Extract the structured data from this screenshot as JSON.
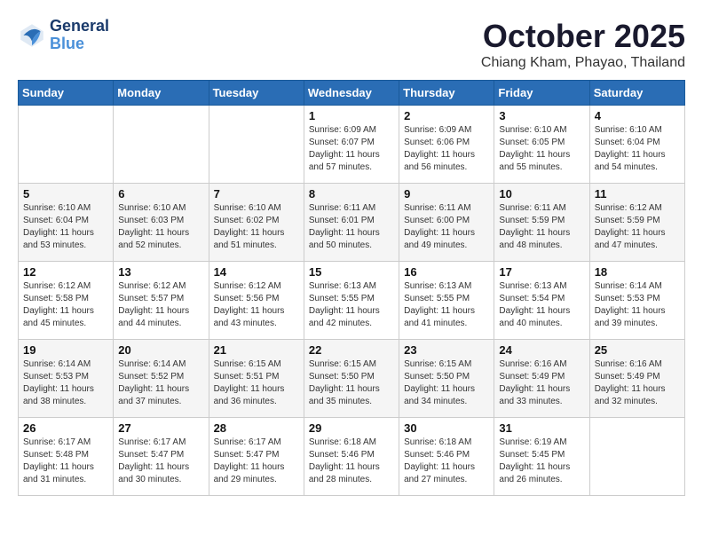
{
  "header": {
    "logo_line1": "General",
    "logo_line2": "Blue",
    "month": "October 2025",
    "location": "Chiang Kham, Phayao, Thailand"
  },
  "weekdays": [
    "Sunday",
    "Monday",
    "Tuesday",
    "Wednesday",
    "Thursday",
    "Friday",
    "Saturday"
  ],
  "weeks": [
    [
      {
        "day": "",
        "info": ""
      },
      {
        "day": "",
        "info": ""
      },
      {
        "day": "",
        "info": ""
      },
      {
        "day": "1",
        "info": "Sunrise: 6:09 AM\nSunset: 6:07 PM\nDaylight: 11 hours\nand 57 minutes."
      },
      {
        "day": "2",
        "info": "Sunrise: 6:09 AM\nSunset: 6:06 PM\nDaylight: 11 hours\nand 56 minutes."
      },
      {
        "day": "3",
        "info": "Sunrise: 6:10 AM\nSunset: 6:05 PM\nDaylight: 11 hours\nand 55 minutes."
      },
      {
        "day": "4",
        "info": "Sunrise: 6:10 AM\nSunset: 6:04 PM\nDaylight: 11 hours\nand 54 minutes."
      }
    ],
    [
      {
        "day": "5",
        "info": "Sunrise: 6:10 AM\nSunset: 6:04 PM\nDaylight: 11 hours\nand 53 minutes."
      },
      {
        "day": "6",
        "info": "Sunrise: 6:10 AM\nSunset: 6:03 PM\nDaylight: 11 hours\nand 52 minutes."
      },
      {
        "day": "7",
        "info": "Sunrise: 6:10 AM\nSunset: 6:02 PM\nDaylight: 11 hours\nand 51 minutes."
      },
      {
        "day": "8",
        "info": "Sunrise: 6:11 AM\nSunset: 6:01 PM\nDaylight: 11 hours\nand 50 minutes."
      },
      {
        "day": "9",
        "info": "Sunrise: 6:11 AM\nSunset: 6:00 PM\nDaylight: 11 hours\nand 49 minutes."
      },
      {
        "day": "10",
        "info": "Sunrise: 6:11 AM\nSunset: 5:59 PM\nDaylight: 11 hours\nand 48 minutes."
      },
      {
        "day": "11",
        "info": "Sunrise: 6:12 AM\nSunset: 5:59 PM\nDaylight: 11 hours\nand 47 minutes."
      }
    ],
    [
      {
        "day": "12",
        "info": "Sunrise: 6:12 AM\nSunset: 5:58 PM\nDaylight: 11 hours\nand 45 minutes."
      },
      {
        "day": "13",
        "info": "Sunrise: 6:12 AM\nSunset: 5:57 PM\nDaylight: 11 hours\nand 44 minutes."
      },
      {
        "day": "14",
        "info": "Sunrise: 6:12 AM\nSunset: 5:56 PM\nDaylight: 11 hours\nand 43 minutes."
      },
      {
        "day": "15",
        "info": "Sunrise: 6:13 AM\nSunset: 5:55 PM\nDaylight: 11 hours\nand 42 minutes."
      },
      {
        "day": "16",
        "info": "Sunrise: 6:13 AM\nSunset: 5:55 PM\nDaylight: 11 hours\nand 41 minutes."
      },
      {
        "day": "17",
        "info": "Sunrise: 6:13 AM\nSunset: 5:54 PM\nDaylight: 11 hours\nand 40 minutes."
      },
      {
        "day": "18",
        "info": "Sunrise: 6:14 AM\nSunset: 5:53 PM\nDaylight: 11 hours\nand 39 minutes."
      }
    ],
    [
      {
        "day": "19",
        "info": "Sunrise: 6:14 AM\nSunset: 5:53 PM\nDaylight: 11 hours\nand 38 minutes."
      },
      {
        "day": "20",
        "info": "Sunrise: 6:14 AM\nSunset: 5:52 PM\nDaylight: 11 hours\nand 37 minutes."
      },
      {
        "day": "21",
        "info": "Sunrise: 6:15 AM\nSunset: 5:51 PM\nDaylight: 11 hours\nand 36 minutes."
      },
      {
        "day": "22",
        "info": "Sunrise: 6:15 AM\nSunset: 5:50 PM\nDaylight: 11 hours\nand 35 minutes."
      },
      {
        "day": "23",
        "info": "Sunrise: 6:15 AM\nSunset: 5:50 PM\nDaylight: 11 hours\nand 34 minutes."
      },
      {
        "day": "24",
        "info": "Sunrise: 6:16 AM\nSunset: 5:49 PM\nDaylight: 11 hours\nand 33 minutes."
      },
      {
        "day": "25",
        "info": "Sunrise: 6:16 AM\nSunset: 5:49 PM\nDaylight: 11 hours\nand 32 minutes."
      }
    ],
    [
      {
        "day": "26",
        "info": "Sunrise: 6:17 AM\nSunset: 5:48 PM\nDaylight: 11 hours\nand 31 minutes."
      },
      {
        "day": "27",
        "info": "Sunrise: 6:17 AM\nSunset: 5:47 PM\nDaylight: 11 hours\nand 30 minutes."
      },
      {
        "day": "28",
        "info": "Sunrise: 6:17 AM\nSunset: 5:47 PM\nDaylight: 11 hours\nand 29 minutes."
      },
      {
        "day": "29",
        "info": "Sunrise: 6:18 AM\nSunset: 5:46 PM\nDaylight: 11 hours\nand 28 minutes."
      },
      {
        "day": "30",
        "info": "Sunrise: 6:18 AM\nSunset: 5:46 PM\nDaylight: 11 hours\nand 27 minutes."
      },
      {
        "day": "31",
        "info": "Sunrise: 6:19 AM\nSunset: 5:45 PM\nDaylight: 11 hours\nand 26 minutes."
      },
      {
        "day": "",
        "info": ""
      }
    ]
  ]
}
